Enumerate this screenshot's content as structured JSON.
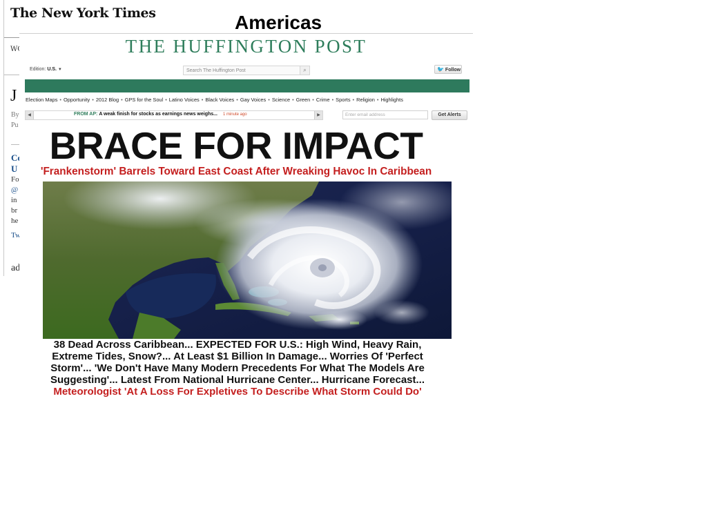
{
  "nyt": {
    "logo": "The New York Times",
    "nav_fragment": "WO",
    "headline_fragment": "J",
    "byline_fragment": "By",
    "published_fragment": "Pu",
    "related_title_1": "Co",
    "related_title_2": "U",
    "body_1": "Fo",
    "body_2": "@",
    "body_3": "in",
    "body_4": "br",
    "body_5": "he",
    "twitter_fragment": "Tw",
    "ad_fragment": "ad"
  },
  "overlay_title": "Americas",
  "huffpost": {
    "logo": "THE HUFFINGTON POST",
    "edition_label": "Edition:",
    "edition_value": "U.S.",
    "search_placeholder": "Search The Huffington Post",
    "follow_label": "Follow",
    "nav": [
      "Election Maps",
      "Opportunity",
      "2012 Blog",
      "GPS for the Soul",
      "Latino Voices",
      "Black Voices",
      "Gay Voices",
      "Science",
      "Green",
      "Crime",
      "Sports",
      "Religion",
      "Highlights"
    ],
    "ticker": {
      "source": "FROM AP:",
      "headline": "A weak finish for stocks as earnings news weighs...",
      "time": "1 minute ago"
    },
    "email_placeholder": "Enter email address",
    "alerts_button": "Get Alerts",
    "headline": "BRACE FOR IMPACT",
    "subhead": "'Frankenstorm' Barrels Toward East Coast After Wreaking Havoc In Caribbean",
    "summary_lines": [
      "38 Dead Across Caribbean... EXPECTED FOR U.S.: High Wind, Heavy Rain,",
      "Extreme Tides, Snow?... At Least $1 Billion In Damage... Worries Of 'Perfect",
      "Storm'... 'We Don't Have Many Modern Precedents For What The Models Are",
      "Suggesting'... Latest From National Hurricane Center... Hurricane Forecast..."
    ],
    "summary_red": "Meteorologist 'At A Loss For Expletives To Describe What Storm Could Do'"
  },
  "colors": {
    "huffpost_green": "#2e7a5d",
    "headline_red": "#c41f1f",
    "link_blue": "#1a4f8a"
  }
}
